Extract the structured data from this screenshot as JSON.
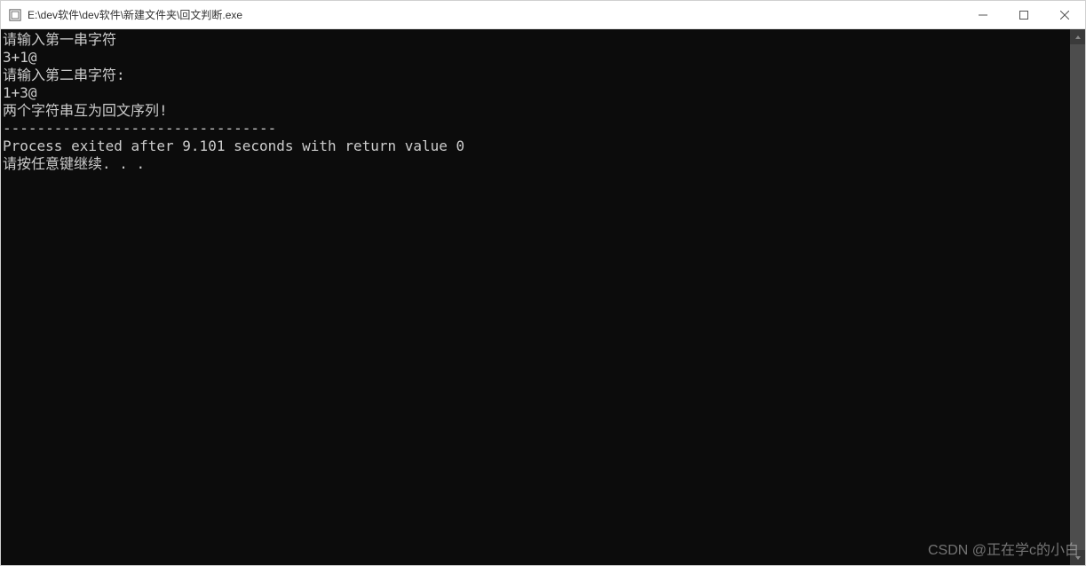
{
  "window": {
    "title": "E:\\dev软件\\dev软件\\新建文件夹\\回文判断.exe"
  },
  "console": {
    "lines": [
      "请输入第一串字符",
      "3+1@",
      "请输入第二串字符:",
      "1+3@",
      "两个字符串互为回文序列!",
      "--------------------------------",
      "Process exited after 9.101 seconds with return value 0",
      "请按任意键继续. . ."
    ]
  },
  "watermark": {
    "text": "CSDN @正在学c的小白"
  }
}
